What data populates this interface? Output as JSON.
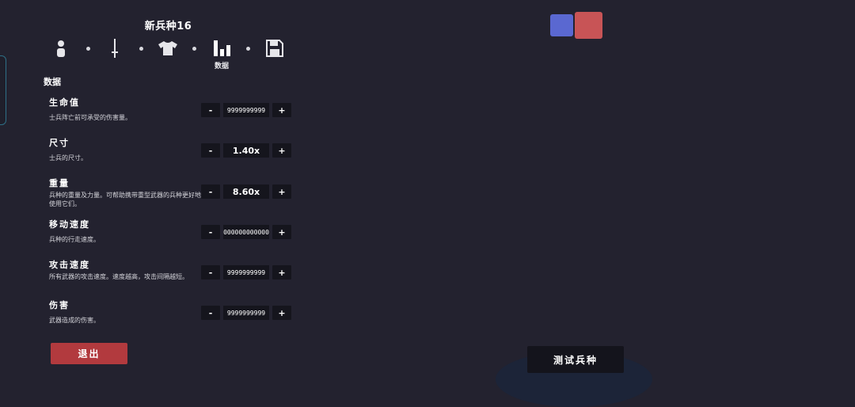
{
  "editor": {
    "unit_title": "新兵种16",
    "steps": [
      {
        "icon": "person-icon"
      },
      {
        "icon": "sword-icon"
      },
      {
        "icon": "shirt-icon"
      },
      {
        "icon": "stats-icon",
        "label": "数据",
        "active": true
      },
      {
        "icon": "save-icon"
      }
    ],
    "section_title": "数据",
    "stats": [
      {
        "name": "生命值",
        "desc": "士兵阵亡前可承受的伤害量。",
        "value": "9999999999",
        "minus": "-",
        "plus": "+"
      },
      {
        "name": "尺寸",
        "desc": "士兵的尺寸。",
        "value": "1.40x",
        "minus": "-",
        "plus": "+"
      },
      {
        "name": "重量",
        "desc": "兵种的重量及力量。可帮助携带重型武器的兵种更好地使用它们。",
        "value": "8.60x",
        "minus": "-",
        "plus": "+"
      },
      {
        "name": "移动速度",
        "desc": "兵种的行走速度。",
        "value": "000000000000",
        "minus": "-",
        "plus": "+"
      },
      {
        "name": "攻击速度",
        "desc": "所有武器的攻击速度。速度越高，攻击间隔越短。",
        "value": "9999999999",
        "minus": "-",
        "plus": "+"
      },
      {
        "name": "伤害",
        "desc": "武器造成的伤害。",
        "value": "9999999999",
        "minus": "-",
        "plus": "+"
      }
    ],
    "exit_label": "退出"
  },
  "preview": {
    "team_colors": {
      "blue": "#5a68d1",
      "red": "#c85456"
    },
    "test_label": "测试兵种"
  }
}
